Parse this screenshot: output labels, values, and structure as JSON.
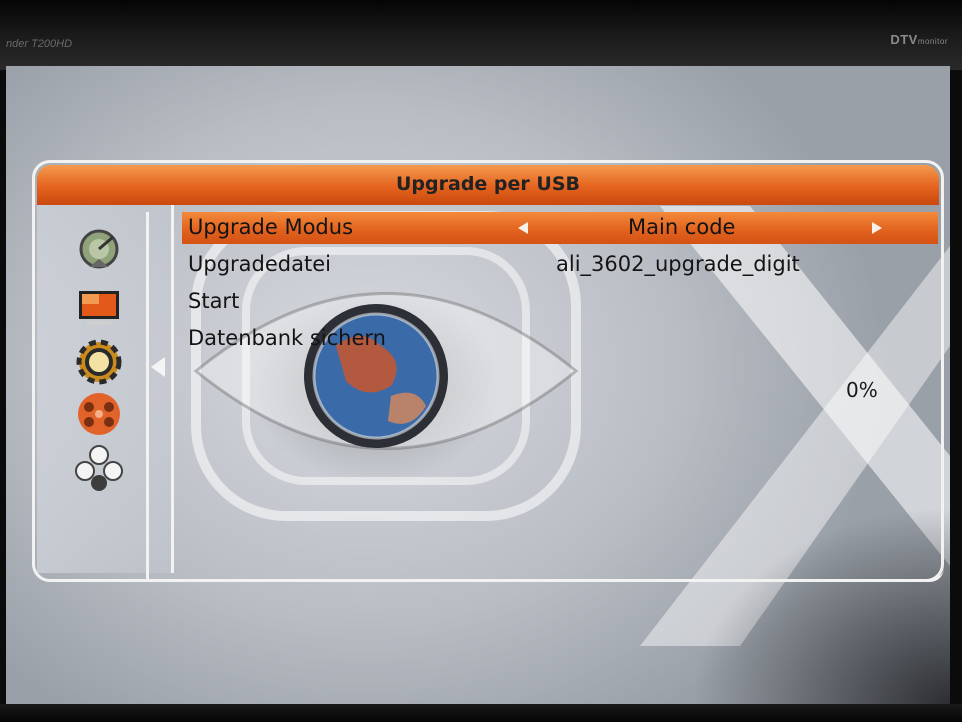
{
  "tv": {
    "brand_left": "nder T200HD",
    "brand_right": "DTV",
    "brand_right_small": "monitor"
  },
  "dialog": {
    "title": "Upgrade per USB",
    "sidebar": {
      "icons": [
        "satellite-dish-icon",
        "tv-picture-icon",
        "gear-settings-icon",
        "film-reel-icon",
        "games-icon"
      ],
      "selected_index": 2
    },
    "rows": [
      {
        "label": "Upgrade Modus",
        "value": "Main code",
        "selected": true
      },
      {
        "label": "Upgradedatei",
        "value": "ali_3602_upgrade_digit"
      },
      {
        "label": "Start",
        "value": ""
      },
      {
        "label": "Datenbank sichern",
        "value": ""
      }
    ],
    "progress": {
      "label": "0%",
      "value": 0
    }
  },
  "colors": {
    "highlight": "#e0601d",
    "titlebar": "#e4631e",
    "frame": "#f2f2f2"
  }
}
